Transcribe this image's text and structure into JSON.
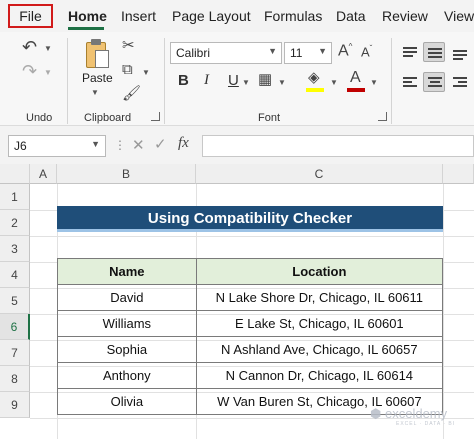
{
  "tabs": [
    "File",
    "Home",
    "Insert",
    "Page Layout",
    "Formulas",
    "Data",
    "Review",
    "View"
  ],
  "active_tab": "Home",
  "ribbon": {
    "undo_group": "Undo",
    "clipboard_group": "Clipboard",
    "font_group": "Font",
    "paste_label": "Paste",
    "font_name": "Calibri",
    "font_size": "11",
    "bold": "B",
    "italic": "I",
    "underline": "U",
    "grow_font": "A",
    "shrink_font": "A",
    "font_color_glyph": "A",
    "accent_color": "#1e7145",
    "fill_color": "#ffff00",
    "font_color": "#c00000"
  },
  "formula_bar": {
    "name_box": "J6",
    "fx": "fx",
    "formula": ""
  },
  "grid": {
    "columns": [
      "A",
      "B",
      "C"
    ],
    "rows": [
      "1",
      "2",
      "3",
      "4",
      "5",
      "6",
      "7",
      "8",
      "9"
    ],
    "selected_row": "6"
  },
  "sheet": {
    "title": "Using Compatibility Checker",
    "headers": [
      "Name",
      "Location"
    ],
    "rows": [
      [
        "David",
        "N Lake Shore Dr, Chicago, IL 60611"
      ],
      [
        "Williams",
        "E Lake St, Chicago, IL 60601"
      ],
      [
        "Sophia",
        "N Ashland Ave, Chicago, IL 60657"
      ],
      [
        "Anthony",
        "N Cannon Dr, Chicago, IL 60614"
      ],
      [
        "Olivia",
        "W Van Buren St, Chicago, IL 60607"
      ]
    ]
  },
  "watermark": {
    "brand": "exceldemy",
    "tagline": "EXCEL · DATA · BI"
  }
}
